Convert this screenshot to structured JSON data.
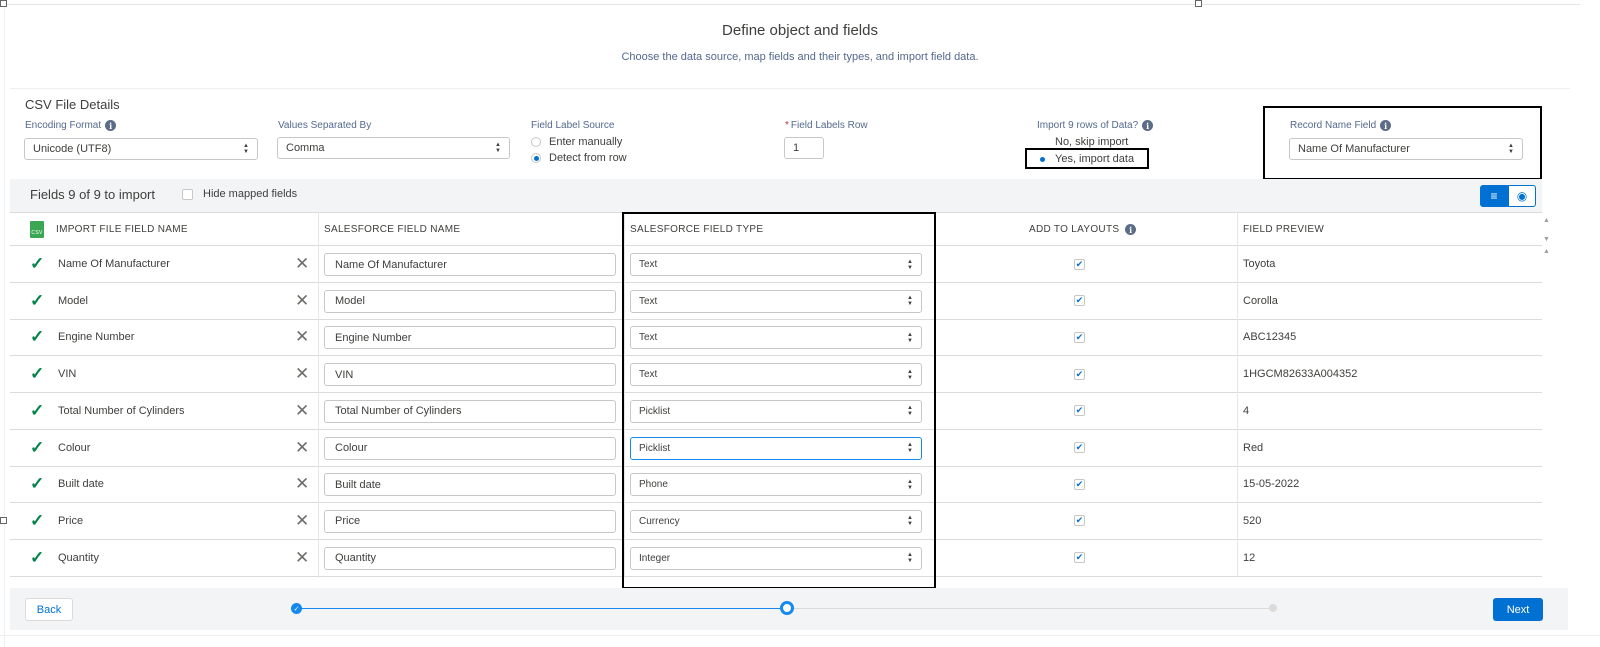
{
  "header": {
    "title": "Define object and fields",
    "subtitle": "Choose the data source, map fields and their types, and import field data."
  },
  "csv": {
    "title": "CSV File Details",
    "encoding_label": "Encoding Format",
    "encoding_value": "Unicode (UTF8)",
    "separator_label": "Values Separated By",
    "separator_value": "Comma",
    "label_source_label": "Field Label Source",
    "label_source_options": [
      "Enter manually",
      "Detect from row"
    ],
    "label_source_selected": "Detect from row",
    "labels_row_required": "*",
    "labels_row_label": "Field Labels Row",
    "labels_row_value": "1",
    "import_label": "Import 9 rows of Data?",
    "import_options": [
      "No, skip import",
      "Yes, import data"
    ],
    "import_selected": "Yes, import data",
    "record_name_label": "Record Name Field",
    "record_name_value": "Name Of Manufacturer"
  },
  "fields_bar": {
    "count_text": "Fields 9 of 9 to import",
    "hide_mapped_label": "Hide mapped fields",
    "hide_mapped_checked": false
  },
  "table": {
    "headers": {
      "import_field": "IMPORT FILE FIELD NAME",
      "sf_field": "SALESFORCE FIELD NAME",
      "sf_type": "SALESFORCE FIELD TYPE",
      "add_layouts": "ADD TO LAYOUTS",
      "preview": "FIELD PREVIEW"
    },
    "csv_icon_text": "CSV",
    "rows": [
      {
        "import_name": "Name Of Manufacturer",
        "sf_name": "Name Of Manufacturer",
        "type": "Text",
        "add_to_layout": true,
        "preview": "Toyota"
      },
      {
        "import_name": "Model",
        "sf_name": "Model",
        "type": "Text",
        "add_to_layout": true,
        "preview": "Corolla"
      },
      {
        "import_name": "Engine Number",
        "sf_name": "Engine Number",
        "type": "Text",
        "add_to_layout": true,
        "preview": "ABC12345"
      },
      {
        "import_name": "VIN",
        "sf_name": "VIN",
        "type": "Text",
        "add_to_layout": true,
        "preview": "1HGCM82633A004352"
      },
      {
        "import_name": "Total Number of Cylinders",
        "sf_name": "Total Number of Cylinders",
        "type": "Picklist",
        "add_to_layout": true,
        "preview": "4"
      },
      {
        "import_name": "Colour",
        "sf_name": "Colour",
        "type": "Picklist",
        "add_to_layout": true,
        "preview": "Red"
      },
      {
        "import_name": "Built date",
        "sf_name": "Built date",
        "type": "Phone",
        "add_to_layout": true,
        "preview": "15-05-2022"
      },
      {
        "import_name": "Price",
        "sf_name": "Price",
        "type": "Currency",
        "add_to_layout": true,
        "preview": "520"
      },
      {
        "import_name": "Quantity",
        "sf_name": "Quantity",
        "type": "Integer",
        "add_to_layout": true,
        "preview": "12"
      }
    ]
  },
  "footer": {
    "back_label": "Back",
    "next_label": "Next",
    "steps_total": 3,
    "current_step": 2
  },
  "colors": {
    "brand_blue": "#0070d2",
    "success_green": "#04844b",
    "text_default": "#3e3e3c",
    "label_grey": "#54698d"
  },
  "icons": [
    "info-icon",
    "check-icon",
    "close-icon",
    "csv-file-icon",
    "list-view-icon",
    "eye-icon",
    "up-down-arrows-icon"
  ]
}
